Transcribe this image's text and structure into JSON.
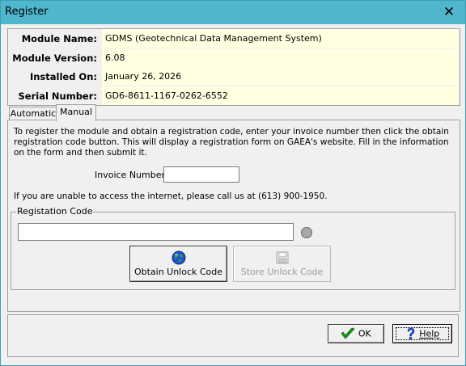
{
  "window": {
    "title": "Register",
    "close_glyph": "✕"
  },
  "info": {
    "rows": [
      {
        "label": "Module Name:",
        "value": "GDMS (Geotechnical Data Management System)"
      },
      {
        "label": "Module Version:",
        "value": "6.08"
      },
      {
        "label": "Installed On:",
        "value": "January 26, 2026"
      },
      {
        "label": "Serial Number:",
        "value": "GD6-8611-1167-0262-6552"
      }
    ]
  },
  "tabs": [
    {
      "label": "Automatic",
      "active": false
    },
    {
      "label": "Manual",
      "active": true
    }
  ],
  "manual": {
    "instructions": "To register the module and obtain a registration code, enter your invoice number then click the obtain registration code button. This will display a registration form on GAEA's website. Fill in the information on the form and then submit it.",
    "invoice_label": "Invoice Number:",
    "invoice_value": "",
    "phone_note": "If you are unable to access the internet, please call us at (613) 900-1950.",
    "registration_group_label": "Registation Code",
    "registration_code_value": "",
    "obtain_button": {
      "label": "Obtain Unlock Code",
      "icon": "globe-icon",
      "enabled": true
    },
    "store_button": {
      "label": "Store Unlock Code",
      "icon": "floppy-disk-icon",
      "enabled": false
    }
  },
  "footer": {
    "ok_label": "OK",
    "ok_icon": "checkmark-icon",
    "help_label": "Help",
    "help_icon": "question-mark-icon"
  },
  "colors": {
    "titlebar": "#4fb6cc",
    "info_value_bg": "#ffffe1",
    "ok_check": "#1a9a1a",
    "help_icon": "#1a4fd0"
  }
}
